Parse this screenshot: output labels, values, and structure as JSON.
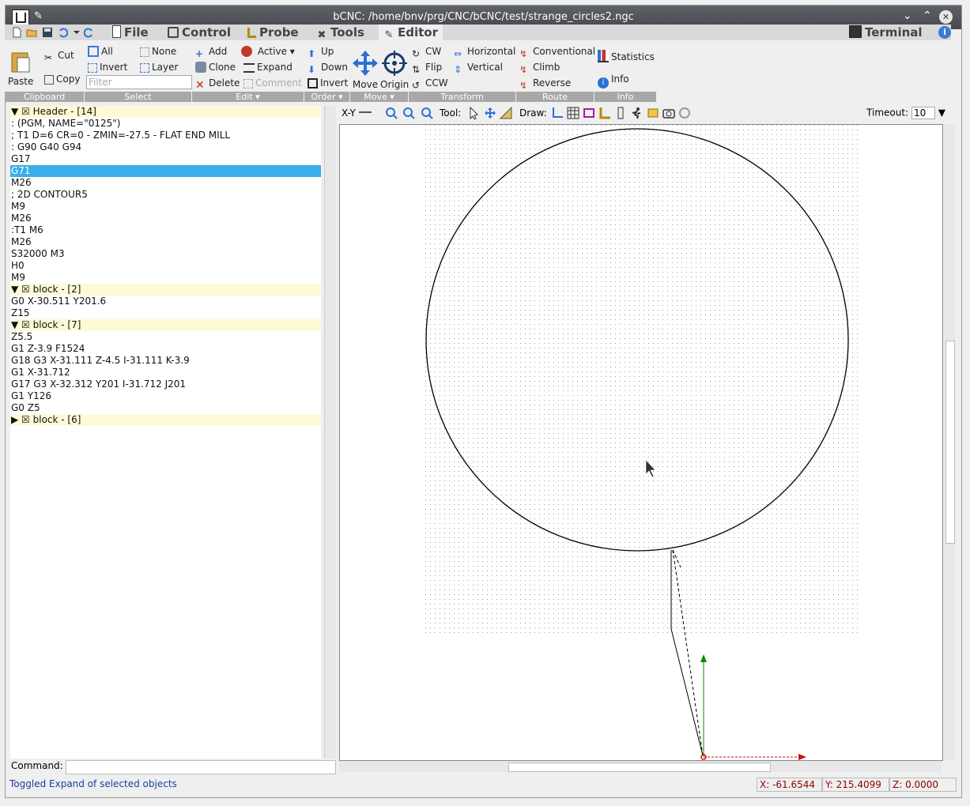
{
  "window": {
    "title": "bCNC:  /home/bnv/prg/CNC/bCNC/test/strange_circles2.ngc"
  },
  "tabs": {
    "file": "File",
    "control": "Control",
    "probe": "Probe",
    "tools": "Tools",
    "editor": "Editor",
    "terminal": "Terminal"
  },
  "ribbon": {
    "clipboard": {
      "paste": "Paste",
      "cut": "Cut",
      "copy": "Copy",
      "caption": "Clipboard"
    },
    "select": {
      "all": "All",
      "none": "None",
      "invert": "Invert",
      "layer": "Layer",
      "filter_placeholder": "Filter",
      "caption": "Select"
    },
    "edit": {
      "add": "Add",
      "active": "Active",
      "clone": "Clone",
      "expand": "Expand",
      "delete": "Delete",
      "comment": "Comment",
      "caption": "Edit"
    },
    "order": {
      "up": "Up",
      "down": "Down",
      "invert": "Invert",
      "caption": "Order"
    },
    "move": {
      "move": "Move",
      "origin": "Origin",
      "caption": "Move"
    },
    "transform": {
      "cw": "CW",
      "horizontal": "Horizontal",
      "flip": "Flip",
      "vertical": "Vertical",
      "ccw": "CCW",
      "caption": "Transform"
    },
    "route": {
      "conventional": "Conventional",
      "climb": "Climb",
      "reverse": "Reverse",
      "caption": "Route"
    },
    "info": {
      "statistics": "Statistics",
      "info": "Info",
      "caption": "Info"
    }
  },
  "tree": {
    "rows": [
      {
        "text": "▼ ☒ Header - [14]",
        "kind": "hdr"
      },
      {
        "text": ": (PGM, NAME=\"0125\")",
        "kind": ""
      },
      {
        "text": "; T1 D=6 CR=0 - ZMIN=-27.5 - FLAT END MILL",
        "kind": ""
      },
      {
        "text": ": G90 G40 G94",
        "kind": ""
      },
      {
        "text": "G17",
        "kind": ""
      },
      {
        "text": "G71",
        "kind": "sel"
      },
      {
        "text": "M26",
        "kind": ""
      },
      {
        "text": "; 2D CONTOUR5",
        "kind": ""
      },
      {
        "text": "M9",
        "kind": ""
      },
      {
        "text": "M26",
        "kind": ""
      },
      {
        "text": ":T1 M6",
        "kind": ""
      },
      {
        "text": "M26",
        "kind": ""
      },
      {
        "text": "S32000 M3",
        "kind": ""
      },
      {
        "text": "H0",
        "kind": ""
      },
      {
        "text": "M9",
        "kind": ""
      },
      {
        "text": "▼ ☒ block - [2]",
        "kind": "hdr"
      },
      {
        "text": "G0 X-30.511 Y201.6",
        "kind": ""
      },
      {
        "text": "Z15",
        "kind": ""
      },
      {
        "text": "▼ ☒ block - [7]",
        "kind": "hdr"
      },
      {
        "text": "Z5.5",
        "kind": ""
      },
      {
        "text": "G1 Z-3.9 F1524",
        "kind": ""
      },
      {
        "text": "G18 G3 X-31.111 Z-4.5 I-31.111 K-3.9",
        "kind": ""
      },
      {
        "text": "G1 X-31.712",
        "kind": ""
      },
      {
        "text": "G17 G3 X-32.312 Y201 I-31.712 J201",
        "kind": ""
      },
      {
        "text": "G1 Y126",
        "kind": ""
      },
      {
        "text": "G0 Z5",
        "kind": ""
      },
      {
        "text": "▶ ☒ block - [6]",
        "kind": "hdr"
      }
    ]
  },
  "command": {
    "label": "Command:",
    "value": ""
  },
  "canvas_toolbar": {
    "view": "X-Y",
    "tool_label": "Tool:",
    "draw_label": "Draw:",
    "timeout_label": "Timeout:",
    "timeout_value": "10"
  },
  "status": {
    "message": "Toggled Expand of selected objects",
    "x": "X: -61.6544",
    "y": "Y: 215.4099",
    "z": "Z: 0.0000"
  },
  "colors": {
    "selection": "#3daee9",
    "header_row": "#fdfbd6",
    "caption_bar": "#a8a8a8",
    "coord_text": "#8b0000",
    "status_text": "#1e3ca0"
  }
}
